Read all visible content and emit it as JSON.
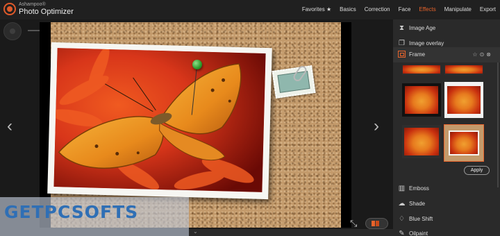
{
  "app": {
    "brand_small": "Ashampoo®",
    "brand_name": "Photo Optimizer"
  },
  "nav": {
    "items": [
      {
        "label": "Favorites ★"
      },
      {
        "label": "Basics"
      },
      {
        "label": "Correction"
      },
      {
        "label": "Face"
      },
      {
        "label": "Effects",
        "active": true
      },
      {
        "label": "Manipulate"
      },
      {
        "label": "Export"
      }
    ]
  },
  "canvas": {
    "prev_arrow": "‹",
    "next_arrow": "›",
    "fit_icon": "⤡"
  },
  "panel": {
    "top_items": [
      {
        "label": "Image Age",
        "icon": "hourglass-icon",
        "glyph": "⧗"
      },
      {
        "label": "Image overlay",
        "icon": "layers-icon",
        "glyph": "❐"
      },
      {
        "label": "Frame",
        "icon": "frame-icon",
        "selected": true
      }
    ],
    "frame_actions": "☆⊙⊗",
    "apply_label": "Apply",
    "bottom_items": [
      {
        "label": "Emboss",
        "icon": "emboss-icon",
        "glyph": "▥"
      },
      {
        "label": "Shade",
        "icon": "cloud-icon",
        "glyph": "☁"
      },
      {
        "label": "Blue Shift",
        "icon": "drop-icon",
        "glyph": "♢"
      },
      {
        "label": "Oilpaint",
        "icon": "brush-icon",
        "glyph": "✎"
      }
    ]
  },
  "watermark": {
    "text": "GETPCSOFTS"
  },
  "colors": {
    "accent": "#e8632b",
    "panel_bg": "#2a2a2a",
    "topbar_bg": "#202020"
  }
}
